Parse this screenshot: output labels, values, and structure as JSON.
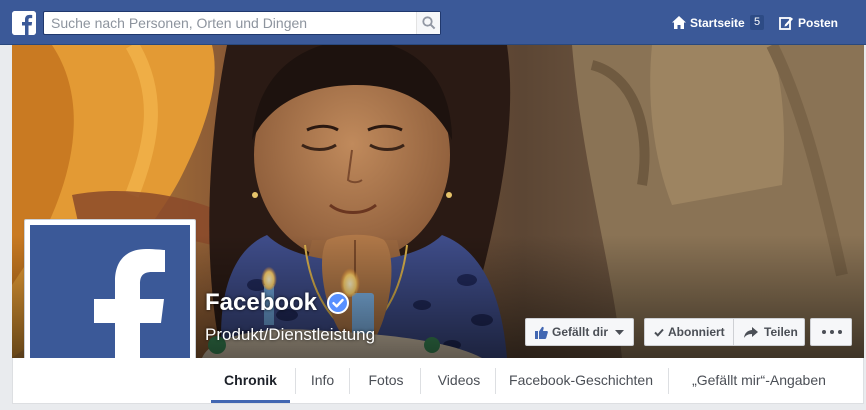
{
  "topbar": {
    "logo_icon": "facebook-f-icon",
    "search_placeholder": "Suche nach Personen, Orten und Dingen",
    "search_icon": "search-icon",
    "home_label": "Startseite",
    "home_count": "5",
    "home_icon": "home-icon",
    "post_label": "Posten",
    "post_icon": "edit-icon"
  },
  "page": {
    "name": "Facebook",
    "category": "Produkt/Dienstleistung",
    "verified_icon": "verified-badge-icon"
  },
  "actions": {
    "like_label": "Gefällt dir",
    "follow_label": "Abonniert",
    "share_label": "Teilen",
    "more_icon": "more-dots-icon"
  },
  "tabs": [
    {
      "label": "Chronik",
      "active": true
    },
    {
      "label": "Info"
    },
    {
      "label": "Fotos"
    },
    {
      "label": "Videos"
    },
    {
      "label": "Facebook-Geschichten"
    },
    {
      "label": "„Gefällt mir“-Angaben"
    }
  ],
  "colors": {
    "brand": "#3b5998",
    "tab_accent": "#4267b2",
    "verified": "#5890ff"
  }
}
